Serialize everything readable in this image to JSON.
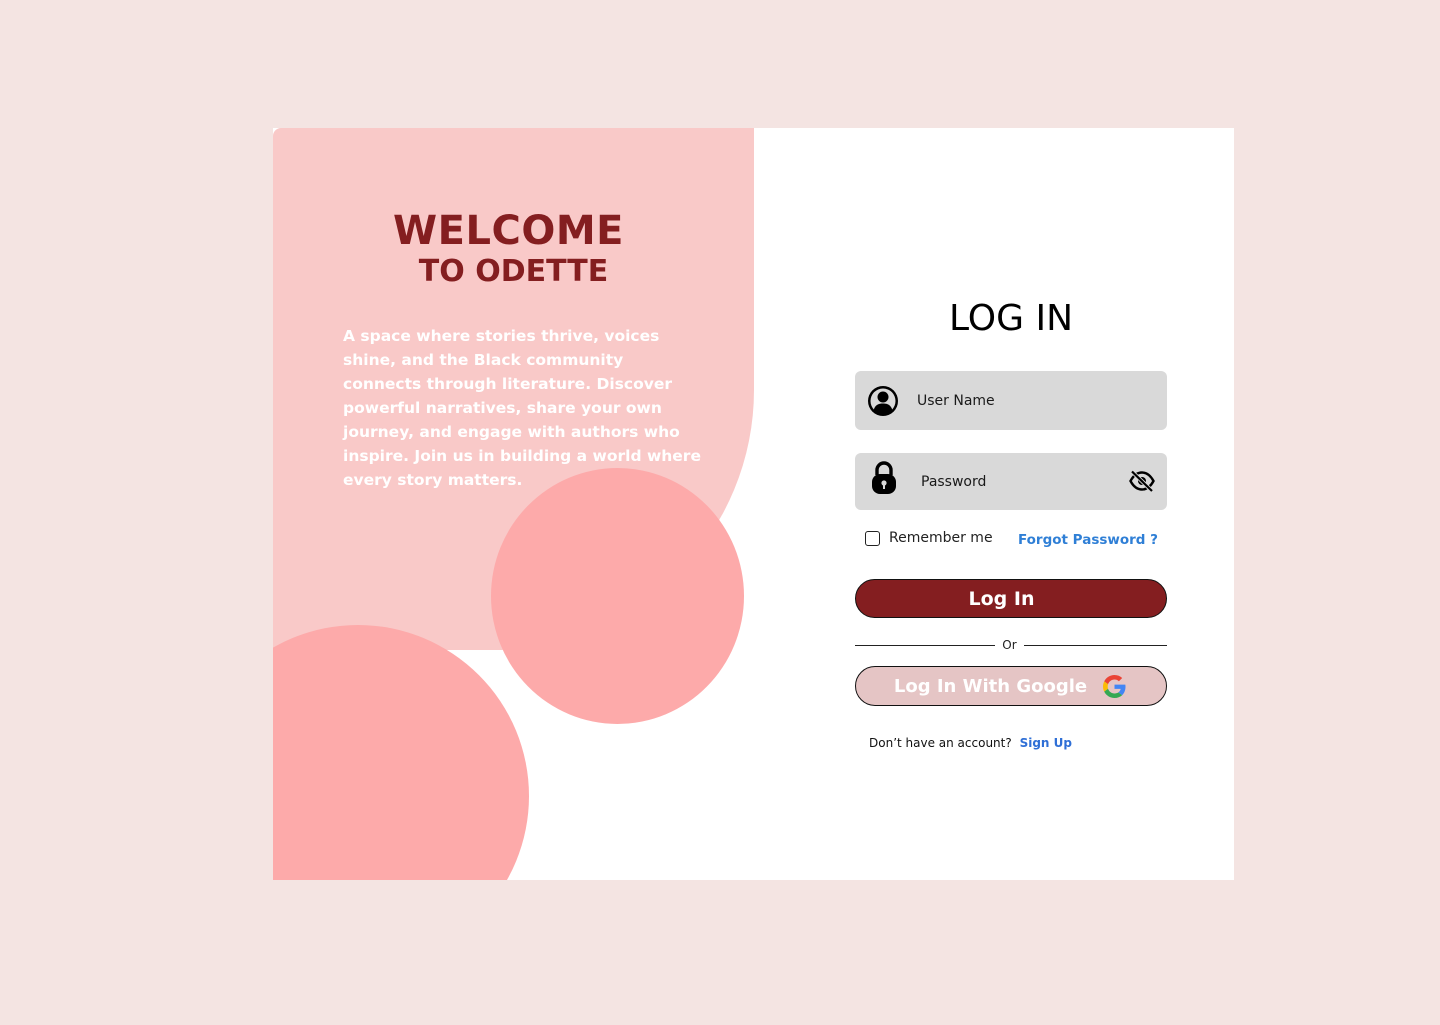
{
  "welcome": {
    "line1": "WELCOME",
    "line2": "TO ODETTE",
    "tagline": "A space where stories thrive, voices shine, and the Black community connects through literature. Discover powerful narratives, share your own journey, and engage with authors who inspire. Join us in building a world where every story matters."
  },
  "login": {
    "title": "LOG IN",
    "username_placeholder": "User Name",
    "username_value": "",
    "password_placeholder": "Password",
    "password_value": "",
    "remember_label": "Remember me",
    "remember_checked": false,
    "forgot_label": "Forgot Password ?",
    "submit_label": "Log In",
    "divider_text": "Or",
    "google_label": "Log In With Google",
    "signup_prompt": "Don’t have an account?",
    "signup_link": "Sign Up"
  },
  "icons": {
    "username": "user-icon",
    "password": "lock-icon",
    "visibility": "eye-off-icon",
    "google": "google-icon"
  },
  "colors": {
    "page_background": "#f4e4e2",
    "panel_pink": "#f9c9c8",
    "circle_pink": "#fdaaaa",
    "brand_maroon": "#841e20",
    "link_blue": "#2f7fd6",
    "field_gray": "#d9d9d9",
    "google_button": "#e5c5c5"
  }
}
